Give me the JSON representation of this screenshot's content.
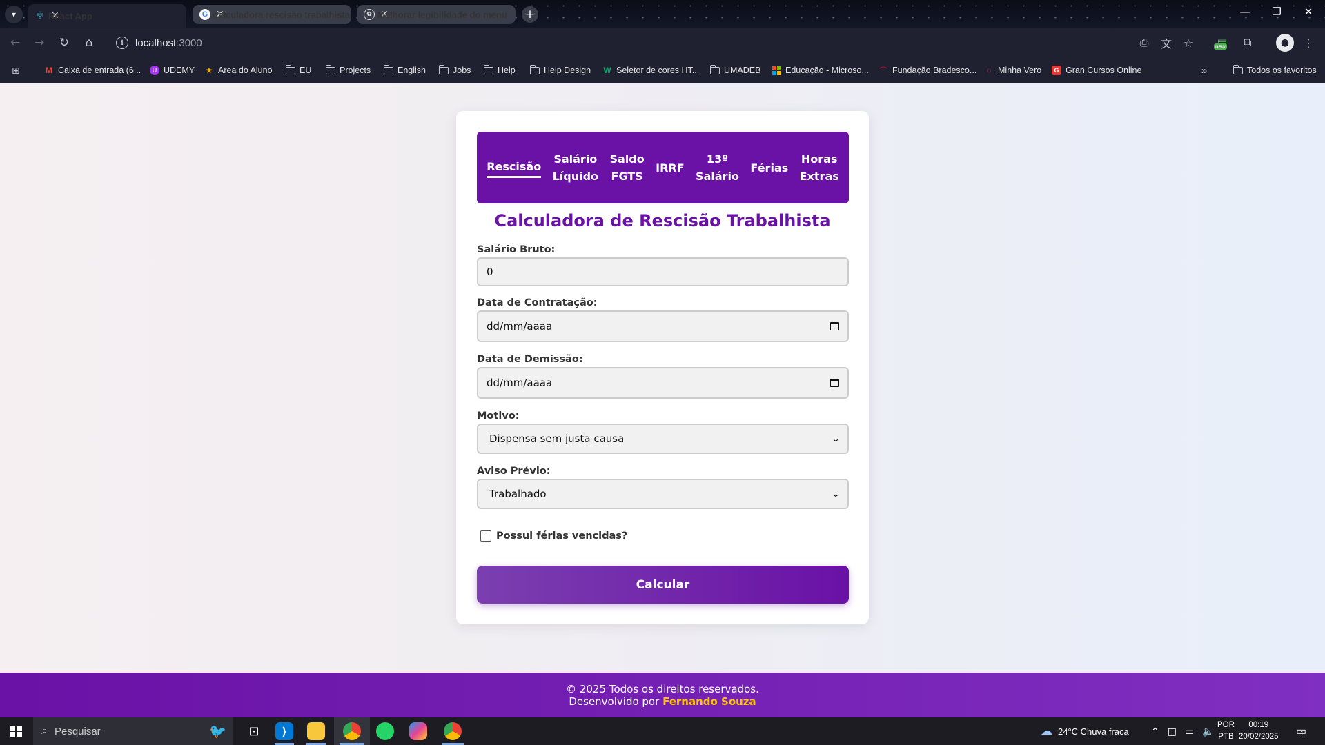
{
  "browser": {
    "tabs": [
      {
        "label": "React App",
        "favicon": "react-icon",
        "active": true
      },
      {
        "label": "calculadora rescisão trabalhista",
        "favicon": "google-icon",
        "active": false
      },
      {
        "label": "Melhorar legibilidade do menu",
        "favicon": "chatgpt-icon",
        "active": false
      }
    ],
    "url_host": "localhost",
    "url_port": ":3000",
    "new_badge": "new",
    "bookmarks": [
      {
        "label": "Caixa de entrada (6...",
        "icon": "gmail-icon"
      },
      {
        "label": "UDEMY",
        "icon": "udemy-icon"
      },
      {
        "label": "Area do Aluno",
        "icon": "star-icon"
      },
      {
        "label": "EU",
        "icon": "folder-icon"
      },
      {
        "label": "Projects",
        "icon": "folder-icon"
      },
      {
        "label": "English",
        "icon": "folder-icon"
      },
      {
        "label": "Jobs",
        "icon": "folder-icon"
      },
      {
        "label": "Help",
        "icon": "folder-icon"
      },
      {
        "label": "Help Design",
        "icon": "folder-icon"
      },
      {
        "label": "Seletor de cores HT...",
        "icon": "w-icon"
      },
      {
        "label": "UMADEB",
        "icon": "folder-icon"
      },
      {
        "label": "Educação - Microso...",
        "icon": "microsoft-icon"
      },
      {
        "label": "Fundação Bradesco...",
        "icon": "bradesco-icon"
      },
      {
        "label": "Minha Vero",
        "icon": "vero-icon"
      },
      {
        "label": "Gran Cursos Online",
        "icon": "gran-icon"
      }
    ],
    "all_bookmarks": "Todos os favoritos"
  },
  "app": {
    "menu": [
      {
        "label": "Rescisão",
        "active": true
      },
      {
        "label": "Salário\nLíquido",
        "active": false
      },
      {
        "label": "Saldo\nFGTS",
        "active": false
      },
      {
        "label": "IRRF",
        "active": false
      },
      {
        "label": "13º\nSalário",
        "active": false
      },
      {
        "label": "Férias",
        "active": false
      },
      {
        "label": "Horas\nExtras",
        "active": false
      }
    ],
    "title": "Calculadora de Rescisão Trabalhista",
    "salario_label": "Salário Bruto:",
    "salario_value": "0",
    "contratacao_label": "Data de Contratação:",
    "contratacao_value": "dd/mm/aaaa",
    "demissao_label": "Data de Demissão:",
    "demissao_value": "dd/mm/aaaa",
    "motivo_label": "Motivo:",
    "motivo_value": "Dispensa sem justa causa",
    "aviso_label": "Aviso Prévio:",
    "aviso_value": "Trabalhado",
    "ferias_label": "Possui férias vencidas?",
    "button": "Calcular",
    "footer_line1": "© 2025 Todos os direitos reservados.",
    "footer_prefix": "Desenvolvido por",
    "footer_author": "Fernando Souza",
    "accent": "#6a11a6"
  },
  "taskbar": {
    "search_placeholder": "Pesquisar",
    "weather": "24°C  Chuva fraca",
    "lang1": "POR",
    "lang2": "PTB",
    "time": "00:19",
    "date": "20/02/2025",
    "notifications": "1"
  }
}
